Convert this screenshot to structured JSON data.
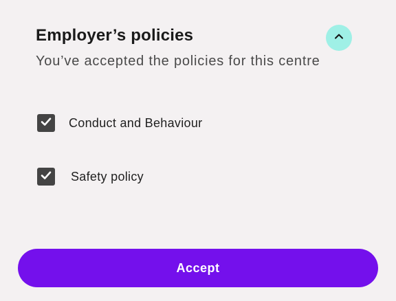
{
  "header": {
    "title": "Employer’s policies",
    "subtitle": "You’ve accepted the policies for this centre",
    "collapse_icon": "chevron-up-icon"
  },
  "policies": [
    {
      "label": "Conduct and Behaviour",
      "checked": true
    },
    {
      "label": "Safety policy",
      "checked": true
    }
  ],
  "actions": {
    "accept_label": "Accept"
  },
  "colors": {
    "background": "#f4f1f2",
    "accent": "#7410ec",
    "collapse_button": "#9ff0e6",
    "checkbox": "#444444"
  }
}
